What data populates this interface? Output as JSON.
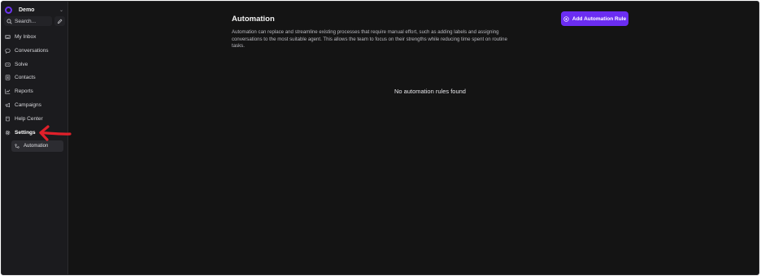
{
  "sidebar": {
    "account_name": "Demo",
    "search_placeholder": "Search...",
    "items": [
      {
        "label": "My Inbox",
        "icon": "inbox-icon"
      },
      {
        "label": "Conversations",
        "icon": "chat-bubble-icon"
      },
      {
        "label": "Solve",
        "icon": "solve-icon"
      },
      {
        "label": "Contacts",
        "icon": "contacts-icon"
      },
      {
        "label": "Reports",
        "icon": "chart-icon"
      },
      {
        "label": "Campaigns",
        "icon": "megaphone-icon"
      },
      {
        "label": "Help Center",
        "icon": "book-icon"
      },
      {
        "label": "Settings",
        "icon": "gear-icon"
      }
    ],
    "active_item": "Settings",
    "sub_item": {
      "label": "Automation",
      "icon": "automation-icon"
    }
  },
  "main": {
    "title": "Automation",
    "description": "Automation can replace and streamline existing processes that require manual effort, such as adding labels and assigning conversations to the most suitable agent. This allows the team to focus on their strengths while reducing time spent on routine tasks.",
    "add_button_label": "Add Automation Rule",
    "empty_state": "No automation rules found"
  },
  "colors": {
    "accent": "#6b2df2",
    "background": "#141414",
    "sidebar": "#1b1b1e",
    "annotation_arrow": "#e0202a"
  }
}
